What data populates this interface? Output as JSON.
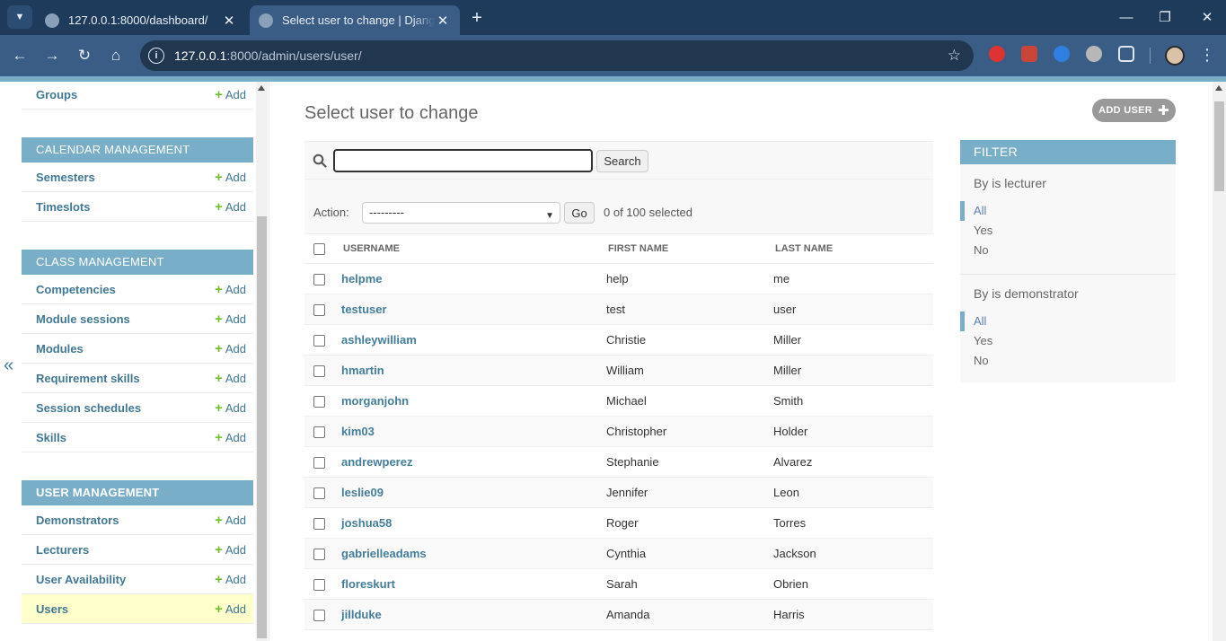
{
  "browser": {
    "tabs": [
      {
        "title": "127.0.0.1:8000/dashboard/",
        "active": false
      },
      {
        "title": "Select user to change | Django site admin",
        "active": true
      }
    ],
    "url_host": "127.0.0.1",
    "url_rest": ":8000/admin/users/user/"
  },
  "sidebar": {
    "sections": [
      {
        "caption": "",
        "items": [
          {
            "name": "Groups",
            "add": "Add"
          }
        ]
      },
      {
        "caption": "CALENDAR MANAGEMENT",
        "items": [
          {
            "name": "Semesters",
            "add": "Add"
          },
          {
            "name": "Timeslots",
            "add": "Add"
          }
        ]
      },
      {
        "caption": "CLASS MANAGEMENT",
        "items": [
          {
            "name": "Competencies",
            "add": "Add"
          },
          {
            "name": "Module sessions",
            "add": "Add"
          },
          {
            "name": "Modules",
            "add": "Add"
          },
          {
            "name": "Requirement skills",
            "add": "Add"
          },
          {
            "name": "Session schedules",
            "add": "Add"
          },
          {
            "name": "Skills",
            "add": "Add"
          }
        ]
      },
      {
        "caption": "USER MANAGEMENT",
        "items": [
          {
            "name": "Demonstrators",
            "add": "Add"
          },
          {
            "name": "Lecturers",
            "add": "Add"
          },
          {
            "name": "User Availability",
            "add": "Add"
          },
          {
            "name": "Users",
            "add": "Add",
            "current": true
          }
        ]
      }
    ],
    "collapse_glyph": "«"
  },
  "content": {
    "title": "Select user to change",
    "add_button": "ADD USER",
    "search": {
      "value": "",
      "button": "Search"
    },
    "actions": {
      "label": "Action:",
      "selected": "---------",
      "go": "Go",
      "counter": "0 of 100 selected"
    },
    "columns": [
      "USERNAME",
      "FIRST NAME",
      "LAST NAME"
    ],
    "rows": [
      {
        "username": "helpme",
        "first": "help",
        "last": "me"
      },
      {
        "username": "testuser",
        "first": "test",
        "last": "user"
      },
      {
        "username": "ashleywilliam",
        "first": "Christie",
        "last": "Miller"
      },
      {
        "username": "hmartin",
        "first": "William",
        "last": "Miller"
      },
      {
        "username": "morganjohn",
        "first": "Michael",
        "last": "Smith"
      },
      {
        "username": "kim03",
        "first": "Christopher",
        "last": "Holder"
      },
      {
        "username": "andrewperez",
        "first": "Stephanie",
        "last": "Alvarez"
      },
      {
        "username": "leslie09",
        "first": "Jennifer",
        "last": "Leon"
      },
      {
        "username": "joshua58",
        "first": "Roger",
        "last": "Torres"
      },
      {
        "username": "gabrielleadams",
        "first": "Cynthia",
        "last": "Jackson"
      },
      {
        "username": "floreskurt",
        "first": "Sarah",
        "last": "Obrien"
      },
      {
        "username": "jillduke",
        "first": "Amanda",
        "last": "Harris"
      }
    ]
  },
  "filter": {
    "title": "FILTER",
    "groups": [
      {
        "heading": "By is lecturer",
        "options": [
          "All",
          "Yes",
          "No"
        ],
        "selected": "All"
      },
      {
        "heading": "By is demonstrator",
        "options": [
          "All",
          "Yes",
          "No"
        ],
        "selected": "All"
      }
    ]
  },
  "colors": {
    "header_blue": "#79aec8",
    "link": "#447e9b",
    "add_green": "#70bf2b",
    "current_row": "#ffffcc",
    "browser_frame": "#1f3b5c"
  }
}
